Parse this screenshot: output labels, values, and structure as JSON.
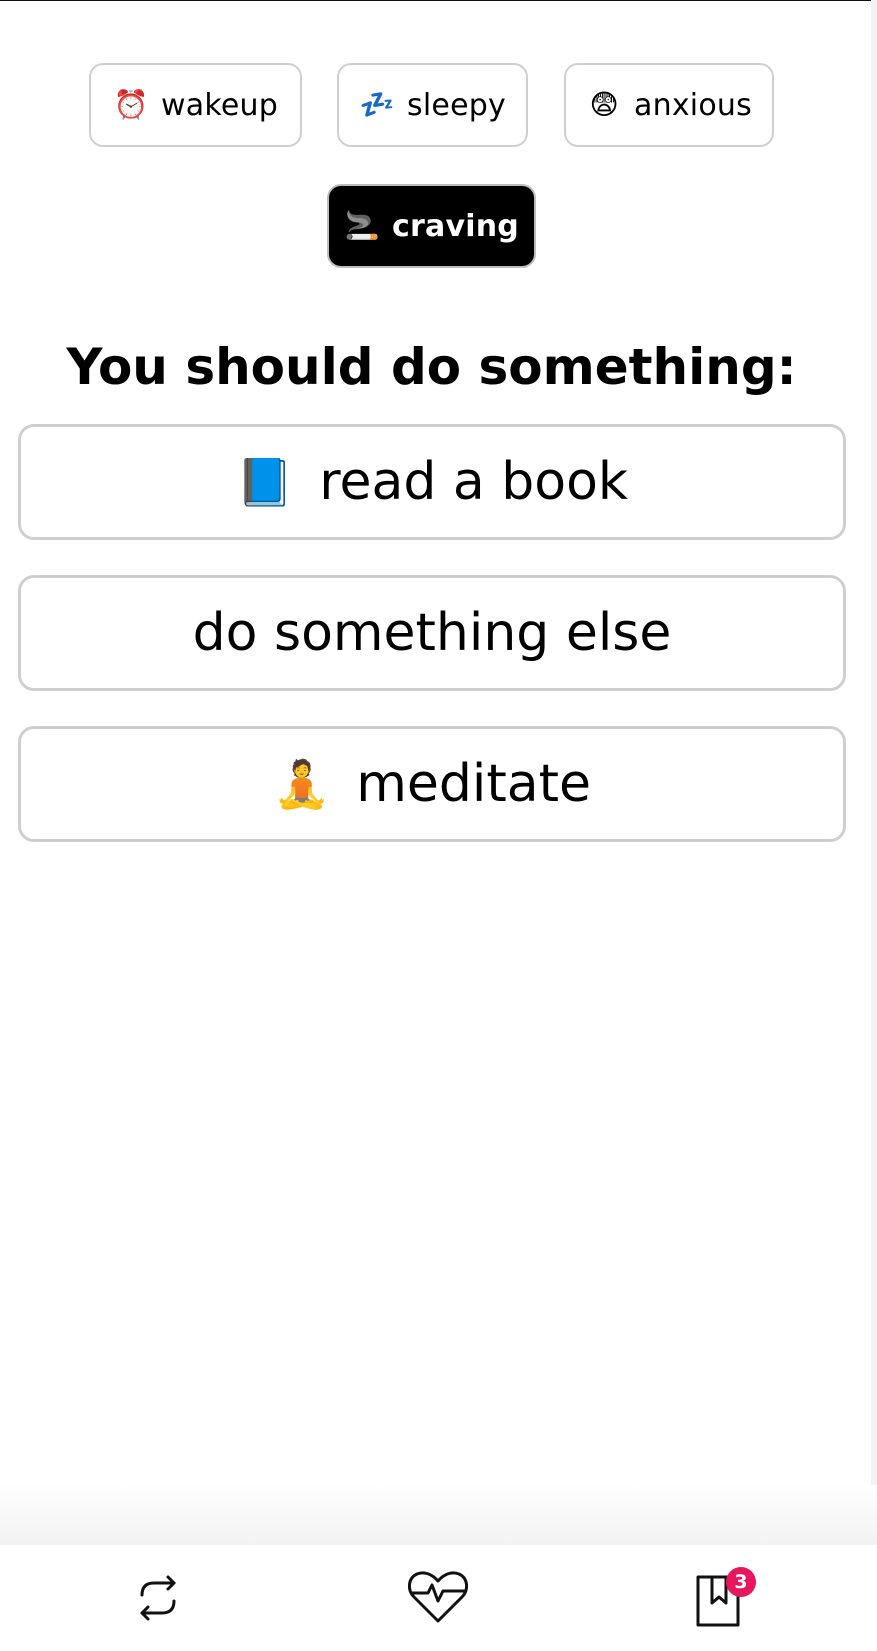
{
  "moods": {
    "items": [
      {
        "label": "wakeup",
        "icon": "alarm-clock-icon",
        "emoji": "⏰",
        "selected": false
      },
      {
        "label": "sleepy",
        "icon": "zzz-icon",
        "emoji": "💤",
        "selected": false
      },
      {
        "label": "anxious",
        "icon": "fearful-face-icon",
        "emoji": "😨",
        "selected": false
      },
      {
        "label": "craving",
        "icon": "cigarette-icon",
        "emoji": "🚬",
        "selected": true
      }
    ]
  },
  "prompt": {
    "heading": "You should do something:"
  },
  "suggestions": [
    {
      "label": "read a book",
      "icon": "blue-book-icon",
      "emoji": "📘"
    },
    {
      "label": "do something else",
      "icon": "",
      "emoji": ""
    },
    {
      "label": "meditate",
      "icon": "person-in-lotus-position-icon",
      "emoji": "🧘"
    }
  ],
  "nav": {
    "items": [
      {
        "icon": "repeat-icon"
      },
      {
        "icon": "heart-pulse-icon"
      },
      {
        "icon": "bookmark-icon",
        "badge": "3"
      }
    ],
    "badge_color": "#e8175d"
  },
  "colors": {
    "selected_chip_bg": "#000000",
    "border": "#cfcfcf"
  }
}
